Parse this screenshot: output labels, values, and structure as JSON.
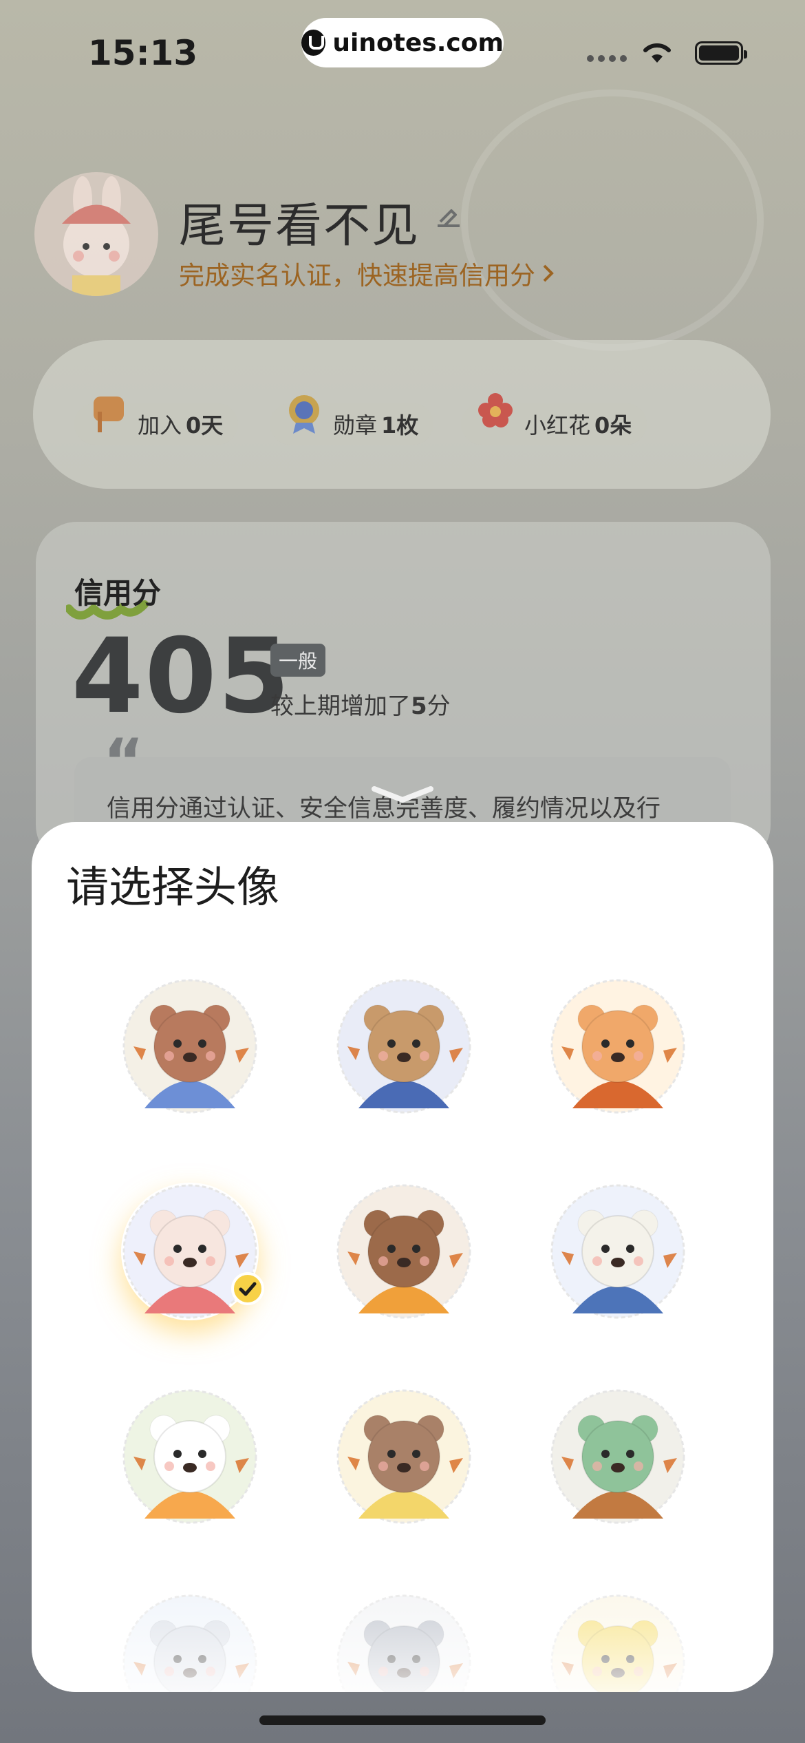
{
  "status_bar": {
    "time": "15:13",
    "site": "uinotes.com"
  },
  "profile": {
    "name": "尾号看不见",
    "verify_link": "完成实名认证，快速提高信用分",
    "avatar_icon": "bunny-avatar-icon"
  },
  "stats": [
    {
      "label": "加入",
      "value": "0天",
      "icon": "flag-icon"
    },
    {
      "label": "勋章",
      "value": "1枚",
      "icon": "medal-icon"
    },
    {
      "label": "小红花",
      "value": "0朵",
      "icon": "red-flower-icon"
    }
  ],
  "credit": {
    "title": "信用分",
    "score": "405",
    "level": "一般",
    "change_prefix": "较上期增加了",
    "change_value": "5",
    "change_suffix": "分",
    "description": "信用分通过认证、安全信息完善度、履约情况以及行"
  },
  "sheet": {
    "title": "请选择头像",
    "selected_index": 3,
    "avatars": [
      {
        "name": "bear-basketball-avatar",
        "bg": "#f4f0e6",
        "face": "#b87a5e",
        "accent": "#6d8fd6"
      },
      {
        "name": "beaver-hat-avatar",
        "bg": "#e9ecf7",
        "face": "#c89a6b",
        "accent": "#4a6bb5"
      },
      {
        "name": "fox-guitar-avatar",
        "bg": "#fff3e2",
        "face": "#f0a86a",
        "accent": "#d9682f"
      },
      {
        "name": "bunny-basket-avatar",
        "bg": "#eef0fb",
        "face": "#f7e6df",
        "accent": "#e9797a"
      },
      {
        "name": "raccoon-goggles-avatar",
        "bg": "#f5ede4",
        "face": "#9c6a4a",
        "accent": "#f0a03a"
      },
      {
        "name": "alpaca-coffee-avatar",
        "bg": "#eef2fb",
        "face": "#f4f2ea",
        "accent": "#4d74b9"
      },
      {
        "name": "panda-hoodie-avatar",
        "bg": "#eef4e4",
        "face": "#ffffff",
        "accent": "#f7a84d"
      },
      {
        "name": "sloth-headphones-avatar",
        "bg": "#fbf4df",
        "face": "#a98168",
        "accent": "#f3d66a"
      },
      {
        "name": "dinosaur-briefcase-avatar",
        "bg": "#f1f0ea",
        "face": "#8fc39a",
        "accent": "#c27a41"
      },
      {
        "name": "cat-cap-avatar",
        "bg": "#eef3fa",
        "face": "#d8dde6",
        "accent": "#6aa5e3"
      },
      {
        "name": "koala-avatar",
        "bg": "#f2f3f5",
        "face": "#b9bec8",
        "accent": "#e5aa63"
      },
      {
        "name": "duck-avatar",
        "bg": "#fbf6e6",
        "face": "#f6de72",
        "accent": "#f08b56"
      }
    ]
  }
}
